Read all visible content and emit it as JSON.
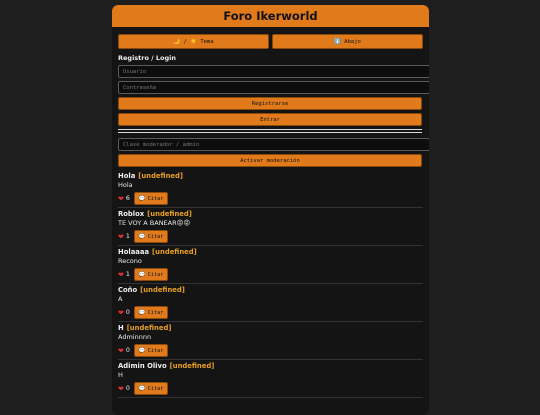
{
  "app": {
    "title": "Foro Ikerworld"
  },
  "toolbar": {
    "theme_label": "🌙 / ☀️ Tema",
    "down_label": "⬇️ Abajo"
  },
  "auth": {
    "section_label": "Registro / Login",
    "user_placeholder": "Usuario",
    "password_placeholder": "Contraseña",
    "register_label": "Registrarse",
    "login_label": "Entrar"
  },
  "moderation": {
    "key_placeholder": "Clave moderador / admin",
    "activate_label": "Activar moderación"
  },
  "posts": [
    {
      "author": "Hola",
      "tag": "[undefined]",
      "text": "Hola",
      "likes": "6",
      "cite_label": "Citar"
    },
    {
      "author": "Roblox",
      "tag": "[undefined]",
      "text": "TE VOY A BANEAR😡😡",
      "likes": "1",
      "cite_label": "Citar"
    },
    {
      "author": "Holaaaa",
      "tag": "[undefined]",
      "text": "Recono",
      "likes": "1",
      "cite_label": "Citar"
    },
    {
      "author": "Coño",
      "tag": "[undefined]",
      "text": "A",
      "likes": "0",
      "cite_label": "Citar"
    },
    {
      "author": "H",
      "tag": "[undefined]",
      "text": "Adminnnn",
      "likes": "0",
      "cite_label": "Citar"
    },
    {
      "author": "Adimin Olivo",
      "tag": "[undefined]",
      "text": "H",
      "likes": "0",
      "cite_label": "Citar"
    }
  ],
  "colors": {
    "accent": "#e07a1a",
    "background": "#141414",
    "tag": "#e8a020",
    "heart": "#e03030"
  },
  "icons": {
    "like": "heart-icon",
    "cite": "speech-bubble-icon"
  }
}
